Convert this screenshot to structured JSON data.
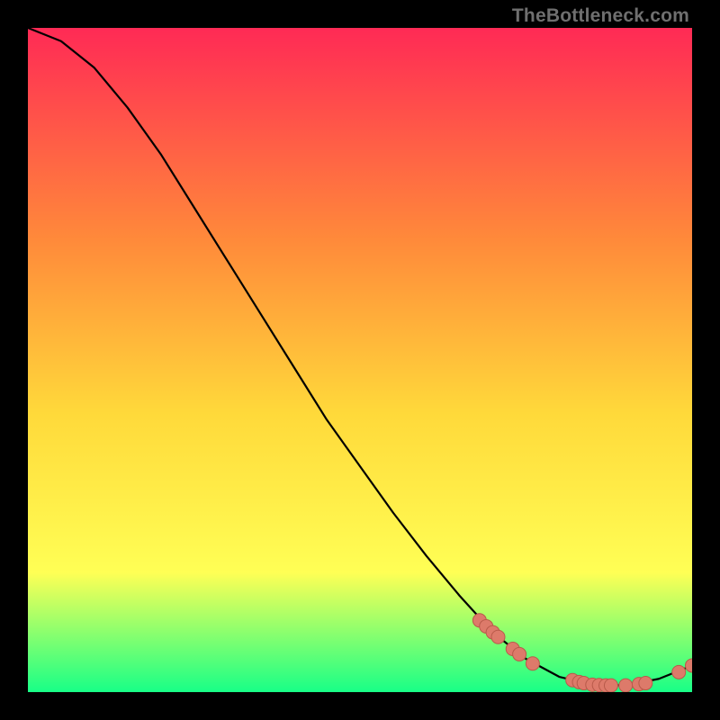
{
  "watermark": "TheBottleneck.com",
  "colors": {
    "bg": "#000000",
    "gradient_top": "#ff2a55",
    "gradient_mid1": "#ff8a3a",
    "gradient_mid2": "#ffd93a",
    "gradient_mid3": "#ffff55",
    "gradient_bottom": "#18ff87",
    "curve": "#000000",
    "marker_fill": "#dd7a6a",
    "marker_stroke": "#b85a4a",
    "watermark": "#6f6f6f"
  },
  "chart_data": {
    "type": "line",
    "title": "",
    "xlabel": "",
    "ylabel": "",
    "xlim": [
      0,
      100
    ],
    "ylim": [
      0,
      100
    ],
    "grid": false,
    "legend": false,
    "curve": [
      {
        "x": 0,
        "y": 100
      },
      {
        "x": 5,
        "y": 98
      },
      {
        "x": 10,
        "y": 94
      },
      {
        "x": 15,
        "y": 88
      },
      {
        "x": 20,
        "y": 81
      },
      {
        "x": 25,
        "y": 73
      },
      {
        "x": 30,
        "y": 65
      },
      {
        "x": 35,
        "y": 57
      },
      {
        "x": 40,
        "y": 49
      },
      {
        "x": 45,
        "y": 41
      },
      {
        "x": 50,
        "y": 34
      },
      {
        "x": 55,
        "y": 27
      },
      {
        "x": 60,
        "y": 20.5
      },
      {
        "x": 65,
        "y": 14.5
      },
      {
        "x": 70,
        "y": 9
      },
      {
        "x": 75,
        "y": 5
      },
      {
        "x": 80,
        "y": 2.3
      },
      {
        "x": 85,
        "y": 1.1
      },
      {
        "x": 90,
        "y": 1.0
      },
      {
        "x": 95,
        "y": 2.0
      },
      {
        "x": 100,
        "y": 4.0
      }
    ],
    "marker_clusters": [
      [
        {
          "x": 68,
          "y": 10.8
        },
        {
          "x": 69,
          "y": 9.9
        },
        {
          "x": 70,
          "y": 9.0
        },
        {
          "x": 70.8,
          "y": 8.3
        },
        {
          "x": 73,
          "y": 6.5
        },
        {
          "x": 74,
          "y": 5.7
        },
        {
          "x": 76,
          "y": 4.3
        }
      ],
      [
        {
          "x": 82,
          "y": 1.8
        },
        {
          "x": 83,
          "y": 1.5
        },
        {
          "x": 83.7,
          "y": 1.35
        },
        {
          "x": 85,
          "y": 1.1
        },
        {
          "x": 86,
          "y": 1.05
        },
        {
          "x": 87,
          "y": 1.0
        },
        {
          "x": 87.8,
          "y": 1.0
        },
        {
          "x": 90,
          "y": 1.0
        },
        {
          "x": 92,
          "y": 1.2
        },
        {
          "x": 93,
          "y": 1.35
        }
      ],
      [
        {
          "x": 98,
          "y": 3.0
        },
        {
          "x": 100,
          "y": 4.0
        }
      ]
    ]
  }
}
